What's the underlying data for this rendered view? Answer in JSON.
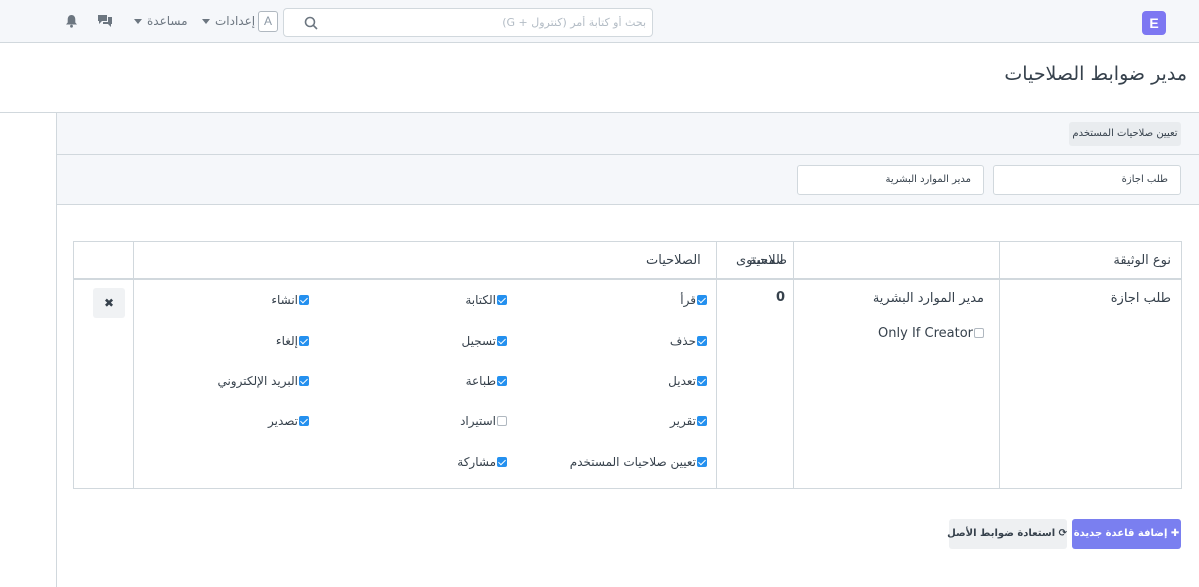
{
  "navbar": {
    "logo": "E",
    "search_placeholder": "بحث أو كتابة أمر (كنترول + G)",
    "avatar_letter": "A",
    "settings_label": "إعدادات",
    "help_label": "مساعدة"
  },
  "page": {
    "title": "مدير ضوابط الصلاحيات"
  },
  "toolbar": {
    "assign_button": "تعيين صلاحيات المستخدم",
    "doctype_filter": "طلب اجازة",
    "role_filter": "مدير الموارد البشرية"
  },
  "table": {
    "headers": {
      "doctype": "نوع الوثيقة",
      "role": "صلاحية",
      "level": "المستوى",
      "permissions": "الصلاحيات"
    },
    "row": {
      "doctype": "طلب اجازة",
      "role": "مدير الموارد البشرية",
      "only_if_creator": "Only If Creator",
      "only_if_creator_checked": false,
      "level": "0",
      "delete_symbol": "✖",
      "permissions": [
        {
          "label": "قرأ",
          "checked": true
        },
        {
          "label": "الكتابة",
          "checked": true
        },
        {
          "label": "انشاء",
          "checked": true
        },
        {
          "label": "حذف",
          "checked": true
        },
        {
          "label": "تسجيل",
          "checked": true
        },
        {
          "label": "إلغاء",
          "checked": true
        },
        {
          "label": "تعديل",
          "checked": true
        },
        {
          "label": "طباعة",
          "checked": true
        },
        {
          "label": "البريد الإلكتروني",
          "checked": true
        },
        {
          "label": "تقرير",
          "checked": true
        },
        {
          "label": "استيراد",
          "checked": false
        },
        {
          "label": "تصدير",
          "checked": true
        },
        {
          "label": "تعيين صلاحيات المستخدم",
          "checked": true
        },
        {
          "label": "مشاركة",
          "checked": true
        }
      ]
    }
  },
  "actions": {
    "add_rule": "إضافة قاعدة جديدة",
    "restore": "استعادة ضوابط الأصل"
  },
  "colors": {
    "accent": "#7a7ff0",
    "checkbox": "#2490ef",
    "navbar_bg": "#f5f7fa"
  }
}
